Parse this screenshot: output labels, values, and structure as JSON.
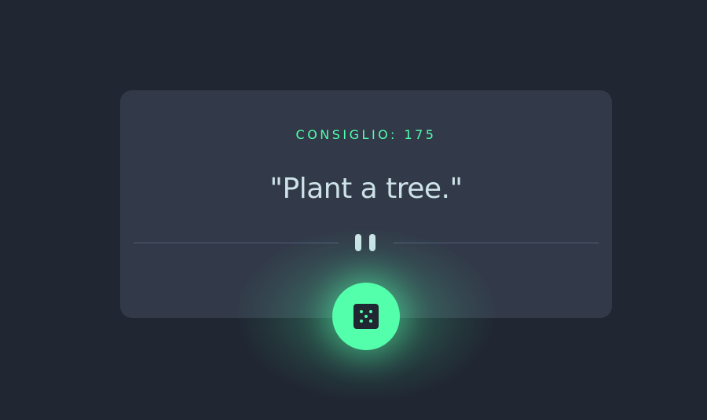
{
  "advice": {
    "id_label": "CONSIGLIO: 175",
    "text": "\"Plant a tree.\""
  },
  "icons": {
    "divider": "pause-icon",
    "button": "dice-icon"
  },
  "colors": {
    "background": "#202632",
    "card": "#323a49",
    "accent": "#53ffab",
    "text": "#cee3e9",
    "divider": "#4f5d74"
  }
}
